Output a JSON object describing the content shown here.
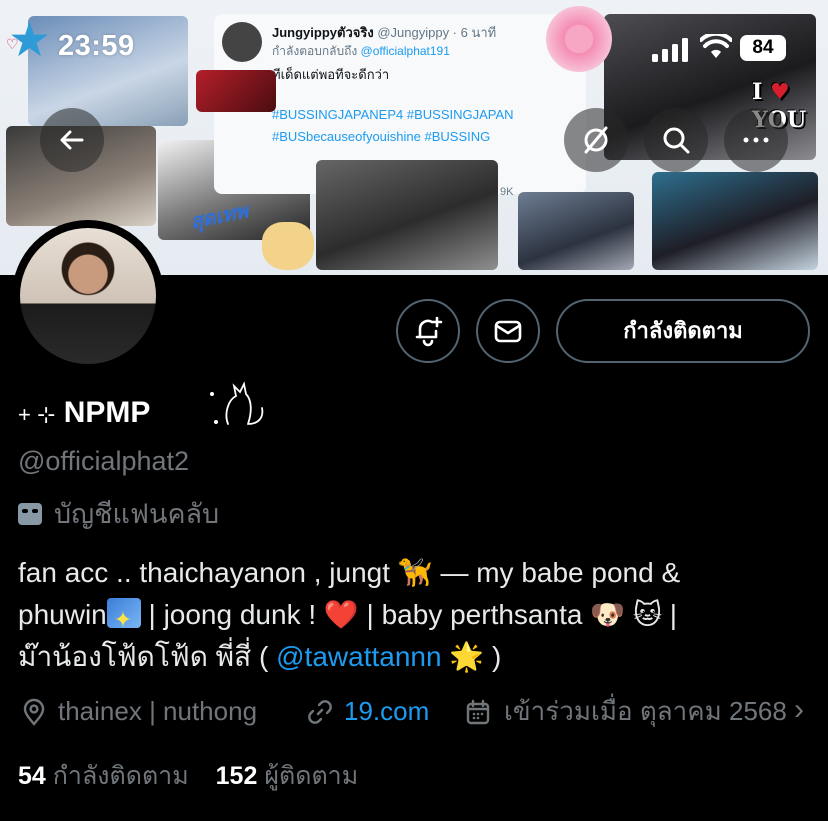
{
  "status_bar": {
    "time": "23:59",
    "battery": "84"
  },
  "banner": {
    "tweet": {
      "name": "Jungyippyตัวจริง",
      "meta": "@Jungyippy · 6 นาที",
      "reply_prefix": "กำลังตอบกลับถึง",
      "reply_mention": "@officialphat191",
      "text": "ทีเด็ดแต่พอทีจะดีกว่า",
      "hashtags": "#BUSSINGJAPANEP4 #BUSSINGJAPAN #BUSbecauseofyouishine #BUSSING",
      "stats": "9K"
    },
    "sticker_text": "I ♥ YOU",
    "sticker_love": "YOU",
    "script_label": "สุดเทพ"
  },
  "profile": {
    "follow_button": "กำลังติดตาม",
    "display_name_prefix": "+ ⊹",
    "display_name": "NPMP",
    "handle": "@officialphat2",
    "badge": "บัญชีแฟนคลับ",
    "bio": {
      "line1": "fan acc .. thaichayanon , jungt 🦮 — my babe pond &",
      "line2_a": "phuwin",
      "line2_b": " | joong dunk ! ❤️ | baby perthsanta 🐶 🐱 |",
      "line3_a": "ม๊าน้องโฟ้ดโฟ้ด พี่สี่ ( ",
      "line3_mention": "@tawattannn",
      "line3_b": " 🌟 )"
    },
    "location": "thainex | nuthong",
    "website": "19.com",
    "joined": "เข้าร่วมเมื่อ ตุลาคม 2568",
    "following_count": "54",
    "following_label": "กำลังติดตาม",
    "followers_count": "152",
    "followers_label": "ผู้ติดตาม"
  },
  "colors": {
    "accent": "#1d9bf0",
    "muted": "#71767b",
    "background": "#000000",
    "border": "#536471"
  },
  "icons": [
    "back-arrow-icon",
    "mute-icon",
    "search-icon",
    "more-icon",
    "bell-plus-icon",
    "mail-icon",
    "location-pin-icon",
    "link-icon",
    "calendar-icon",
    "chevron-right-icon"
  ]
}
